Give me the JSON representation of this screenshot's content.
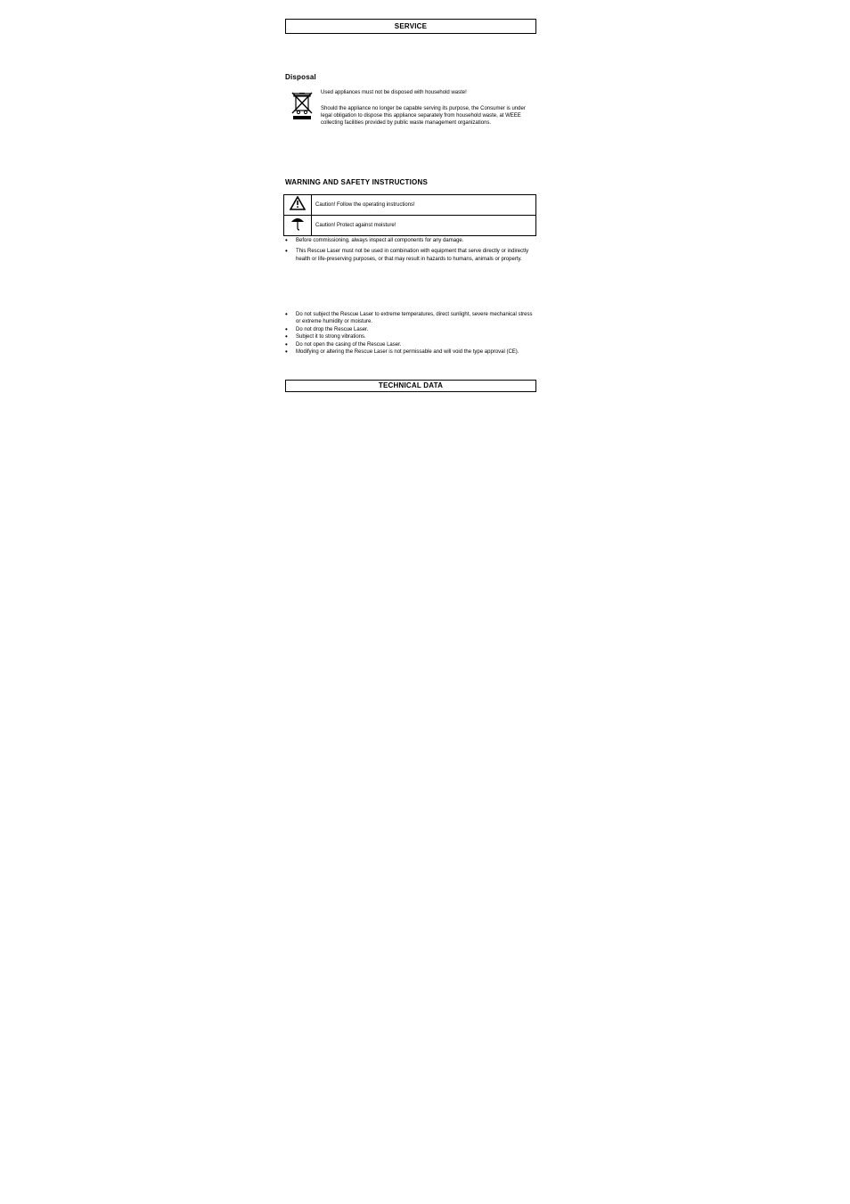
{
  "service_box_title": "SERVICE",
  "section_disposal": "Disposal",
  "disposal_p1": "Used appliances must not be disposed with household waste!",
  "disposal_p2": "Should the appliance no longer be capable serving its purpose, the Consumer is under legal obligation to dispose this appliance separately from household waste, at WEEE collecting facilities provided by public waste management organizations.",
  "section_safety": "WARNING AND SAFETY INSTRUCTIONS",
  "warning_rows": [
    {
      "icon": "warning-triangle-icon",
      "text": "Caution! Follow the operating instructions!"
    },
    {
      "icon": "umbrella-icon",
      "text": "Caution! Protect against moisture!"
    }
  ],
  "bullets_group1": [
    "Before commissioning, always inspect all components for any damage.",
    "This Rescue Laser must not be used in combination with equipment that serve directly or indirectly health or life-preserving purposes, or that may result in hazards to humans, animals or property."
  ],
  "bullets_group2": [
    "Do not subject the Rescue Laser to extreme temperatures, direct sunlight, severe mechanical stress or extreme humidity or moisture.",
    "Do not drop the Rescue Laser.",
    "Subject it to strong vibrations.",
    "Do not open the casing of the Rescue Laser.",
    "Modifying or altering the Rescue Laser is not permissable and will void the type approval (CE)."
  ],
  "tech_box_title": "TECHNICAL DATA",
  "icons": {
    "weee_label": "WEEE crossed-out bin symbol",
    "warning_label": "Warning triangle",
    "umbrella_label": "Keep dry umbrella"
  }
}
